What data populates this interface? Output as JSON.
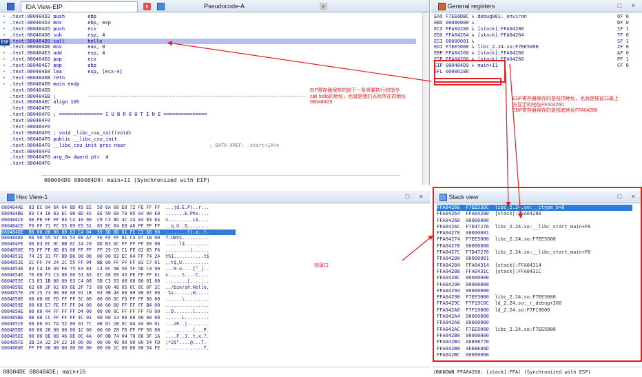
{
  "ida_tabs": {
    "ida_view": "IDA View-EIP",
    "pseudocode": "Pseudocode-A"
  },
  "registers_title": "General registers",
  "hex_title": "Hex View-1",
  "stack_title": "Stack view",
  "code_lines": [
    {
      "a": ".text:080484D2",
      "m": "push",
      "o": "ebp",
      "c": ""
    },
    {
      "a": ".text:080484D3",
      "m": "mov",
      "o": "ebp, esp",
      "c": ""
    },
    {
      "a": ".text:080484D5",
      "m": "push",
      "o": "ecx",
      "c": ""
    },
    {
      "a": ".text:080484D6",
      "m": "sub",
      "o": "esp, 4",
      "c": ""
    },
    {
      "a": ".text:080484D9",
      "m": "call",
      "o": "hello",
      "c": ""
    },
    {
      "a": ".text:080484DE",
      "m": "mov",
      "o": "eax, 0",
      "c": ""
    },
    {
      "a": ".text:080484E3",
      "m": "add",
      "o": "esp, 4",
      "c": ""
    },
    {
      "a": ".text:080484E6",
      "m": "pop",
      "o": "ecx",
      "c": ""
    },
    {
      "a": ".text:080484E7",
      "m": "pop",
      "o": "ebp",
      "c": ""
    },
    {
      "a": ".text:080484E8",
      "m": "lea",
      "o": "esp, [ecx-4]",
      "c": ""
    },
    {
      "a": ".text:080484EB",
      "m": "retn",
      "o": "",
      "c": ""
    },
    {
      "a": ".text:080484EB",
      "m": "main endp",
      "o": "",
      "c": ""
    },
    {
      "a": ".text:080484EB",
      "m": "",
      "o": "",
      "c": ""
    },
    {
      "a": ".text:080484EB",
      "m": ";",
      "o": "---------------------------------------------------------------------------",
      "c": ""
    },
    {
      "a": ".text:080484EC",
      "m": "align 10h",
      "o": "",
      "c": ""
    },
    {
      "a": ".text:080484F0",
      "m": "",
      "o": "",
      "c": ""
    },
    {
      "a": ".text:080484F0",
      "m": "; =============== S U B R O U T I N E ===============",
      "o": "",
      "c": ""
    },
    {
      "a": ".text:080484F0",
      "m": "",
      "o": "",
      "c": ""
    },
    {
      "a": ".text:080484F0",
      "m": "",
      "o": "",
      "c": ""
    },
    {
      "a": ".text:080484F0",
      "m": "; void _libc_csu_init(void)",
      "o": "",
      "c": ""
    },
    {
      "a": ".text:080484F0",
      "m": "public __libc_csu_init",
      "o": "",
      "c": ""
    },
    {
      "a": ".text:080484F0",
      "m": "__libc_csu_init proc near",
      "o": "",
      "c": "; DATA XREF: _start+10↑o"
    },
    {
      "a": ".text:080484F0",
      "m": "",
      "o": "",
      "c": ""
    },
    {
      "a": ".text:080484F0",
      "m": "arg_0= dword ptr  4",
      "o": "",
      "c": ""
    },
    {
      "a": ".text:080484F0",
      "m": "",
      "o": "",
      "c": ""
    }
  ],
  "code_status": "000004D9 080484D9: main+11 (Synchronized with EIP)",
  "registers": [
    "EAX F7EE6DBC ↳ debug001:_environ",
    "EBX 00000000 ↳",
    "ECX FFA04280 ↳ [stack]:FFA04280",
    "EDX FFA04264 ↳ [stack]:FFA04264",
    "ESI 00000001 ↳",
    "EDI F7EE5000 ↳ libc_2.24.so:F7EE5000",
    "EBP FFA04268 ↳ [stack]:FFA04268",
    "ESP FFA04260 ↳ [stack]:FFA04260",
    "EIP 080484D9 ↳ main+11",
    "EFL 00000286"
  ],
  "flags": [
    "OF 0",
    "DF 0",
    "IF 1",
    "TF 0",
    "SF 1",
    "ZF 0",
    "AF 0",
    "PF 1",
    "CF 0"
  ],
  "notes": {
    "eip": "EIP寄存器保存的是下一条将要执行的指令\ncall hello的地址，也就是我们光标所在的地址\n080484D9",
    "esp": "ESP寄存器保存的是栈顶地址，也就是栈窗口最上\n方显示的地址FFA04260\nEBP寄存器保存的是栈底地址FFA04268",
    "stack": "栈窗口"
  },
  "hex_rows": [
    "080484AE  83 EC 04 6A 64 8D 45 EE  50 6A 00 E8 72 FE FF FF  ...jd.E.Pj..r...",
    "080484BE  83 C4 10 83 EC 08 8D 45  EE 50 68 70 85 04 08 E8  .......E.Phx....",
    "080484CE  6E FE FF FF 83 C4 10 90  C9 C3 8D 4C 24 04 83 E4  n.........L$....",
    "080484CE  F0 FF 71 FC 55 89 E5 51  83 EC 04 E8 A6 FF FF FF  ..q.U..Q........",
    "080484DE  B8 00 00 00 00 83 C4 04  59 5D 8D 61 FC C3 66 90  ........Y].a..f.",
    "080484EE  66 90 55 57 56 53 E8 A7  FE FF FF 81 C3 07 1B 00  f.UWVS..........",
    "080484FE  00 83 EC 0C 8B 6C 24 20  8D B3 0C FF FF FF E8 0B  .....l$ ........",
    "0804850E  FD FF FF 8D 83 08 FF FF  FF 29 C6 C1 FE 02 85 F6  .........)......",
    "0804851E  74 25 31 FF 8D B6 00 00  00 00 83 EC 04 FF 74 24  t%1...........t$",
    "0804852E  2C FF 74 24 2C 55 FF 94  BB 08 FF FF FF 83 C7 01  ,.t$,U..........",
    "0804853E  83 C4 10 39 FE 75 E3 83  C4 0C 5B 5E 5F 5D C3 90  ...9.u....[^_]..",
    "0804854E  76 00 F3 C3 00 00 53 83  EC 08 E8 43 FE FF FF 81  v.....S....C....",
    "0804855E  C3 03 1B 00 00 83 C4 08  5B C3 03 00 00 00 01 00  ........[.......",
    "0804856E  02 00 2F 62 69 6E 2F 73  68 00 48 65 6C 6C 6F 2C  ../bin/sh.Hello,",
    "0804857E  20 25 73 00 00 00 01 1B  03 3B 48 00 00 00 07 00   %s......;H.....",
    "0804858E  00 00 8C FD FF FF 5C 00  00 00 DC FD FF FF 80 00  ......\\.........",
    "0804859E  00 00 E7 FE FF FF 94 00  00 00 00 FF FF FF B4 00  ................",
    "080485AE  00 00 44 FF FF FF D4 00  00 00 6C FF FF FF F0 00  ..D.......l.....",
    "080485BE  00 00 CC FF FF FF 4C 01  00 00 14 00 00 00 00 00  ......L.........",
    "080485CE  00 00 01 7A 52 00 01 7C  08 01 1B 0C 04 04 88 01  ...zR..|........",
    "080485DE  00 00 20 00 00 00 1C 00  00 00 28 FD FF FF 50 00  .. .......(...P.",
    "080485EE  00 00 0E 08 46 0E 0C 4A  0F 0B 74 04 78 00 3F 1A  ....F..J..t.x.?.",
    "080485FE  3B 2A 32 24 22 10 00 00  00 00 40 00 00 00 54 FD  ;*2$\"....@...T.",
    "0804860E  FF FF 08 00 00 00 00 00  00 00 1C 00 00 00 54 FE  ..............T."
  ],
  "hex_status": "00004DE 080484DE: main+16",
  "stack_rows": [
    {
      "a": "FFA04260",
      "v": "F7EE53DC",
      "c": "libc_2.24.so:__ctype_b+8"
    },
    {
      "a": "FFA04264",
      "v": "FFA04280",
      "c": "[stack]:FFA04280"
    },
    {
      "a": "FFA04268",
      "v": "00000000",
      "c": ""
    },
    {
      "a": "FFA0426C",
      "v": "F7D47276",
      "c": "libc_2.24.so:__libc_start_main+F6"
    },
    {
      "a": "FFA04270",
      "v": "00000001",
      "c": ""
    },
    {
      "a": "FFA04274",
      "v": "F7EE5000",
      "c": "libc_2.24.so:F7EE5000"
    },
    {
      "a": "FFA04278",
      "v": "00000000",
      "c": ""
    },
    {
      "a": "FFA0427C",
      "v": "F7D47276",
      "c": "libc_2.24.so:__libc_start_main+F6"
    },
    {
      "a": "FFA04280",
      "v": "00000001",
      "c": ""
    },
    {
      "a": "FFA04284",
      "v": "FFA04314",
      "c": "[stack]:FFA04314"
    },
    {
      "a": "FFA04288",
      "v": "FFA0431C",
      "c": "[stack]:FFA0431C"
    },
    {
      "a": "FFA0428C",
      "v": "00000000",
      "c": ""
    },
    {
      "a": "FFA04290",
      "v": "00000000",
      "c": ""
    },
    {
      "a": "FFA04294",
      "v": "00000000",
      "c": ""
    },
    {
      "a": "FFA04298",
      "v": "F7EE5000",
      "c": "libc_2.24.so:F7EE5000"
    },
    {
      "a": "FFA0429C",
      "v": "F7F19C0C",
      "c": "ld_2.24.so:_r_debug+300"
    },
    {
      "a": "FFA042A0",
      "v": "F7F19000",
      "c": "ld_2.24.so:F7F19000"
    },
    {
      "a": "FFA042A4",
      "v": "00000000",
      "c": ""
    },
    {
      "a": "FFA042A8",
      "v": "00000000",
      "c": ""
    },
    {
      "a": "FFA042AC",
      "v": "F7EE5000",
      "c": "libc_2.24.so:F7EE5000"
    },
    {
      "a": "FFA042B0",
      "v": "00000000",
      "c": ""
    },
    {
      "a": "FFA042B4",
      "v": "A6898770",
      "c": ""
    },
    {
      "a": "FFA042B8",
      "v": "4EEBE86D",
      "c": ""
    },
    {
      "a": "FFA042BC",
      "v": "00000000",
      "c": ""
    }
  ],
  "stack_status": "UNKNOWN FFA04260: [stack]:FFA( (Synchronized with ESP)",
  "window_buttons": "□ ×",
  "colors": {
    "annotation": "#e02020",
    "selection": "#2f7bd8",
    "eip_highlight": "#b8bdf0"
  }
}
